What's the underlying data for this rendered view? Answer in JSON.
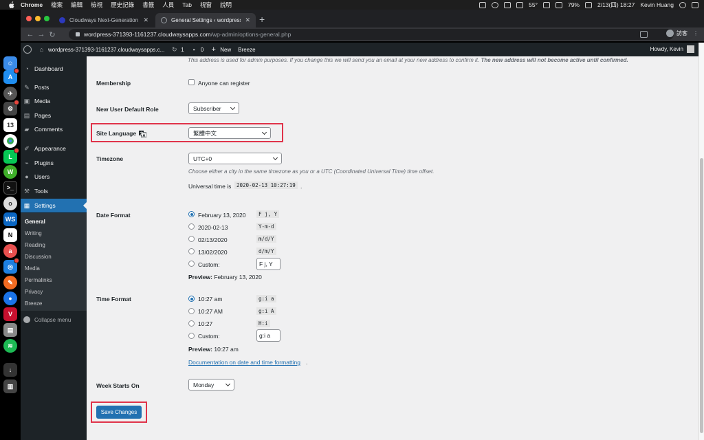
{
  "menubar": {
    "app": "Chrome",
    "items": [
      "檔案",
      "編輯",
      "檢視",
      "歷史記錄",
      "書籤",
      "人員",
      "Tab",
      "視窗",
      "說明"
    ],
    "temp": "55°",
    "battery_pct": "79%",
    "datetime": "2/13(四) 18:27",
    "user": "Kevin Huang"
  },
  "browser": {
    "tabs": [
      {
        "title": "Cloudways Next-Generation C"
      },
      {
        "title": "General Settings ‹ wordpress-"
      }
    ],
    "url_host": "wordpress-371393-1161237.cloudwaysapps.com",
    "url_path": "/wp-admin/options-general.php",
    "profile": "訪客"
  },
  "adminbar": {
    "site": "wordpress-371393-1161237.cloudwaysapps.c...",
    "updates": "1",
    "comments": "0",
    "new": "New",
    "breeze": "Breeze",
    "howdy": "Howdy, Kevin"
  },
  "sidebar": {
    "items": [
      {
        "label": "Dashboard",
        "icon": "dashboard-icon"
      },
      {
        "label": "Posts",
        "icon": "pin-icon"
      },
      {
        "label": "Media",
        "icon": "media-icon"
      },
      {
        "label": "Pages",
        "icon": "page-icon"
      },
      {
        "label": "Comments",
        "icon": "comment-icon"
      },
      {
        "label": "Appearance",
        "icon": "brush-icon"
      },
      {
        "label": "Plugins",
        "icon": "plugin-icon"
      },
      {
        "label": "Users",
        "icon": "user-icon"
      },
      {
        "label": "Tools",
        "icon": "wrench-icon"
      },
      {
        "label": "Settings",
        "icon": "settings-icon"
      }
    ],
    "submenu": [
      "General",
      "Writing",
      "Reading",
      "Discussion",
      "Media",
      "Permalinks",
      "Privacy",
      "Breeze"
    ],
    "collapse": "Collapse menu"
  },
  "settings": {
    "email_note": "This address is used for admin purposes. If you change this we will send you an email at your new address to confirm it.",
    "email_note_bold": "The new address will not become active until confirmed.",
    "membership": {
      "label": "Membership",
      "checkbox": "Anyone can register",
      "checked": false
    },
    "default_role": {
      "label": "New User Default Role",
      "value": "Subscriber"
    },
    "site_language": {
      "label": "Site Language",
      "value": "繁體中文"
    },
    "timezone": {
      "label": "Timezone",
      "value": "UTC+0",
      "hint": "Choose either a city in the same timezone as you or a UTC (Coordinated Universal Time) time offset.",
      "universal_prefix": "Universal time is",
      "universal_time": "2020-02-13 10:27:19",
      "universal_suffix": "."
    },
    "date_format": {
      "label": "Date Format",
      "options": [
        {
          "display": "February 13, 2020",
          "code": "F j, Y",
          "checked": true
        },
        {
          "display": "2020-02-13",
          "code": "Y-m-d",
          "checked": false
        },
        {
          "display": "02/13/2020",
          "code": "m/d/Y",
          "checked": false
        },
        {
          "display": "13/02/2020",
          "code": "d/m/Y",
          "checked": false
        }
      ],
      "custom_label": "Custom:",
      "custom_value": "F j, Y",
      "preview_label": "Preview:",
      "preview_value": "February 13, 2020"
    },
    "time_format": {
      "label": "Time Format",
      "options": [
        {
          "display": "10:27 am",
          "code": "g:i a",
          "checked": true
        },
        {
          "display": "10:27 AM",
          "code": "g:i A",
          "checked": false
        },
        {
          "display": "10:27",
          "code": "H:i",
          "checked": false
        }
      ],
      "custom_label": "Custom:",
      "custom_value": "g:i a",
      "preview_label": "Preview:",
      "preview_value": "10:27 am",
      "doc_link": "Documentation on date and time formatting",
      "doc_link_suffix": "."
    },
    "week_starts": {
      "label": "Week Starts On",
      "value": "Monday"
    },
    "save_button": "Save Changes"
  },
  "colors": {
    "wp_blue": "#2271b1",
    "wp_dark": "#1d2327",
    "highlight_red": "#e0334a"
  }
}
